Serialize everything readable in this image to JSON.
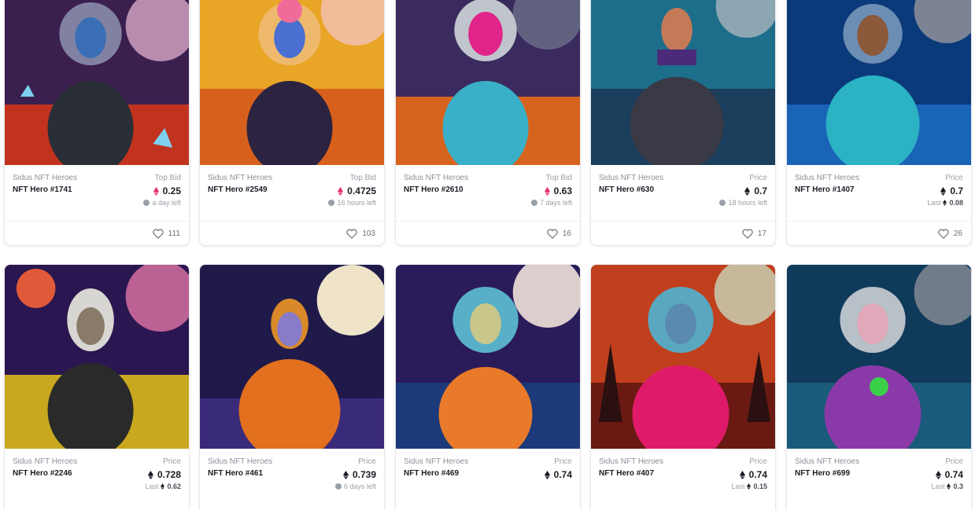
{
  "colors": {
    "eth_pink": "#e5306f",
    "eth_dark": "#1a1d24",
    "muted_text": "#9aa0a8",
    "card_border": "#e6e8ec"
  },
  "icons": {
    "currency": "ethereum-icon",
    "time": "clock-icon",
    "favorite": "heart-icon"
  },
  "cards": [
    {
      "collection": "Sidus NFT Heroes",
      "name": "NFT Hero #1741",
      "price_label": "Top Bid",
      "price": "0.25",
      "sub_text": "a day left",
      "sub_type": "time",
      "likes": "111"
    },
    {
      "collection": "Sidus NFT Heroes",
      "name": "NFT Hero #2549",
      "price_label": "Top Bid",
      "price": "0.4725",
      "sub_text": "16 hours left",
      "sub_type": "time",
      "likes": "103"
    },
    {
      "collection": "Sidus NFT Heroes",
      "name": "NFT Hero #2610",
      "price_label": "Top Bid",
      "price": "0.63",
      "sub_text": "7 days left",
      "sub_type": "time",
      "likes": "16"
    },
    {
      "collection": "Sidus NFT Heroes",
      "name": "NFT Hero #630",
      "price_label": "Price",
      "price": "0.7",
      "sub_text": "18 hours left",
      "sub_type": "time",
      "likes": "17"
    },
    {
      "collection": "Sidus NFT Heroes",
      "name": "NFT Hero #1407",
      "price_label": "Price",
      "price": "0.7",
      "sub_label": "Last",
      "sub_text": "0.08",
      "sub_type": "last",
      "likes": "26"
    },
    {
      "collection": "Sidus NFT Heroes",
      "name": "NFT Hero #2246",
      "price_label": "Price",
      "price": "0.728",
      "sub_label": "Last",
      "sub_text": "0.62",
      "sub_type": "last"
    },
    {
      "collection": "Sidus NFT Heroes",
      "name": "NFT Hero #461",
      "price_label": "Price",
      "price": "0.739",
      "sub_text": "6 days left",
      "sub_type": "time"
    },
    {
      "collection": "Sidus NFT Heroes",
      "name": "NFT Hero #469",
      "price_label": "Price",
      "price": "0.74",
      "sub_type": "none"
    },
    {
      "collection": "Sidus NFT Heroes",
      "name": "NFT Hero #407",
      "price_label": "Price",
      "price": "0.74",
      "sub_label": "Last",
      "sub_text": "0.15",
      "sub_type": "last"
    },
    {
      "collection": "Sidus NFT Heroes",
      "name": "NFT Hero #699",
      "price_label": "Price",
      "price": "0.74",
      "sub_label": "Last",
      "sub_text": "0.3",
      "sub_type": "last"
    }
  ]
}
